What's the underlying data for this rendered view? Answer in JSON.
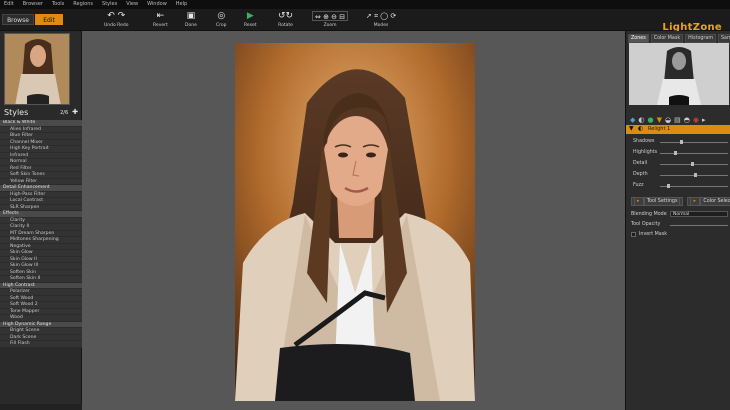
{
  "menubar": [
    "Edit",
    "Browser",
    "Tools",
    "Regions",
    "Styles",
    "View",
    "Window",
    "Help"
  ],
  "modes": {
    "browse": "Browse",
    "edit": "Edit"
  },
  "toolbar": {
    "undo_redo": "Undo Redo",
    "revert": "Revert",
    "done": "Done",
    "crop": "Crop",
    "reset": "Reset",
    "rotate": "Rotate",
    "zoom": "Zoom",
    "modes": "Modes"
  },
  "brand": "LightZone",
  "styles": {
    "title": "Styles",
    "count_label": "2/6",
    "groups": [
      {
        "name": "Black & White",
        "items": [
          "Alien Infrared",
          "Blue Filter",
          "Channel Mixer",
          "High Key Portrait",
          "Infrared",
          "Normal",
          "Red Filter",
          "Soft Skin Tones",
          "Yellow Filter"
        ]
      },
      {
        "name": "Detail Enhancement",
        "items": [
          "High-Pass Filter",
          "Local Contrast",
          "SLR Sharpen"
        ]
      },
      {
        "name": "Effects",
        "items": [
          "Clarity",
          "Clarity II",
          "MT Dream Sharpen",
          "Midtones Sharpening",
          "Negative",
          "Skin Glow",
          "Skin Glow II",
          "Skin Glow III",
          "Soften Skin",
          "Soften Skin II"
        ]
      },
      {
        "name": "High Contrast",
        "items": [
          "Polarizer",
          "Soft Wood",
          "Soft Wood 2",
          "Tone Mapper",
          "Wood"
        ]
      },
      {
        "name": "High Dynamic Range",
        "items": [
          "Bright Scene",
          "Dark Scene",
          "Fill Flash"
        ]
      }
    ]
  },
  "right": {
    "tabs": [
      "Zones",
      "Color Mask",
      "Histogram",
      "Sampler"
    ],
    "tool_name": "Relight 1",
    "sliders": [
      {
        "label": "Shadows",
        "value": 0.3
      },
      {
        "label": "Highlights",
        "value": 0.2
      },
      {
        "label": "Detail",
        "value": 0.45
      },
      {
        "label": "Depth",
        "value": 0.5
      },
      {
        "label": "Fuzz",
        "value": 0.1
      }
    ],
    "settings_tabs": [
      "Tool Settings",
      "Color Selection"
    ],
    "blending_label": "Blending Mode",
    "blending_value": "Normal",
    "opacity_label": "Tool Opacity",
    "invert_label": "Invert Mask"
  },
  "colors": {
    "accent": "#e18a10",
    "canvas": "#575757",
    "panel": "#2a2a2a"
  }
}
